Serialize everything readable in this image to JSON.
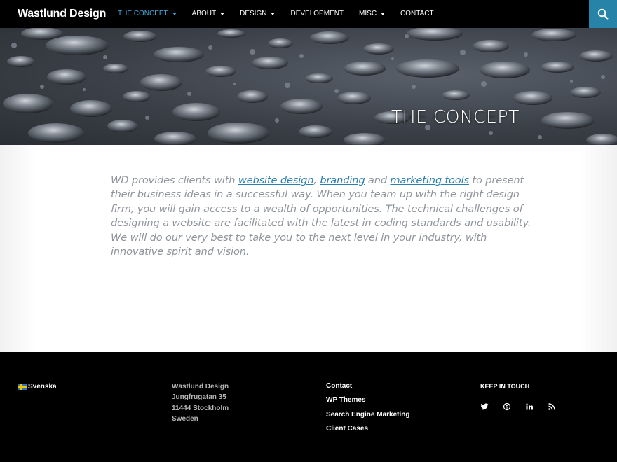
{
  "header": {
    "brand": "Wastlund Design",
    "nav": [
      {
        "label": "The Concept",
        "active": true,
        "dropdown": true
      },
      {
        "label": "About",
        "active": false,
        "dropdown": true
      },
      {
        "label": "Design",
        "active": false,
        "dropdown": true
      },
      {
        "label": "Development",
        "active": false,
        "dropdown": false
      },
      {
        "label": "Misc",
        "active": false,
        "dropdown": true
      },
      {
        "label": "Contact",
        "active": false,
        "dropdown": false
      }
    ],
    "search_icon": "search-icon"
  },
  "hero": {
    "title": "THE CONCEPT"
  },
  "content": {
    "intro_before": "WD provides clients with ",
    "link_website_design": "website design",
    "sep1": ", ",
    "link_branding": "branding",
    "sep2": " and ",
    "link_marketing_tools": "marketing tools",
    "intro_after": " to present their business ideas in a successful way. When you team up with the right design firm, you will gain access to a wealth of opportunities. The technical challenges of designing a website are facilitated with the latest in coding standards and usability. We will do our very best to take you to the next level in your industry, with innovative spirit and vision."
  },
  "footer": {
    "language": "Svenska",
    "address": {
      "name": "Wästlund Design",
      "street": "Jungfrugatan 35",
      "city": "11444 Stockholm",
      "country": "Sweden"
    },
    "links": [
      "Contact",
      "WP Themes",
      "Search Engine Marketing",
      "Client Cases"
    ],
    "keep_in_touch": "Keep in touch",
    "social_icons": [
      "twitter-icon",
      "skype-icon",
      "linkedin-icon",
      "rss-icon"
    ]
  },
  "colors": {
    "accent": "#41a8db",
    "search_bg": "#2784a8",
    "link": "#2b7fb0"
  }
}
